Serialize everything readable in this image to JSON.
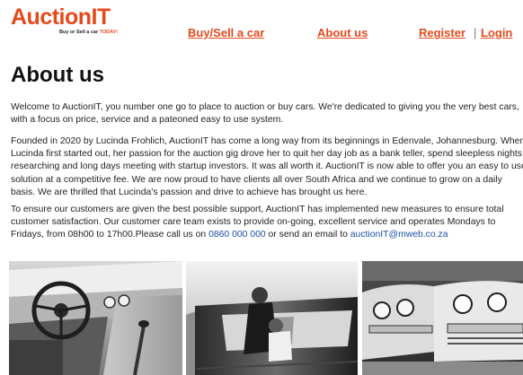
{
  "logo": {
    "text": "AuctionIT",
    "tagline_prefix": "Buy or Sell a car",
    "tagline_highlight": "TODAY!"
  },
  "nav": {
    "buy_sell": "Buy/Sell a car",
    "about": "About us",
    "register": "Register",
    "separator": "|",
    "login": "Login"
  },
  "page": {
    "title": "About us",
    "intro": {
      "line1": "Welcome to AuctionIT, you number one go to place to auction or buy cars. We're dedicated to giving you the very best cars,",
      "line2": "with a focus on price, service and a pateoned easy to use system."
    },
    "founded": {
      "line1": "Founded in 2020 by Lucinda Frohlich, AuctionIT has come a long way from its beginnings in Edenvale, Johannesburg. When",
      "line2": "Lucinda first started out, her passion for the auction gig drove her to quit her day job as a bank teller, spend sleepless nights",
      "line3": "researching and long days meeting with startup investors. It was all worth it. AuctionIT is now able to offer you an easy to use",
      "line4": "solution at a competitive fee. We are now proud to have clients all over South Africa and we continue to grow on a daily",
      "line5": "basis. We are thrilled that Lucinda's passion and drive to achieve has brought us here."
    },
    "support": {
      "line1": "To ensure our customers are given the best possible support, AuctionIT has implemented new measures to ensure total",
      "line2": "customer satisfaction. Our customer care team exists to provide on-going, excellent service and operates Mondays to",
      "line3_before": "Fridays, from 08h00 to 17h00.Please call us on ",
      "phone": "0860 000 000",
      "line3_middle": " or send an email to ",
      "email": "auctionIT@mweb.co.za"
    }
  },
  "colors": {
    "brand": "#e34a1c",
    "link": "#1a4fa3"
  }
}
